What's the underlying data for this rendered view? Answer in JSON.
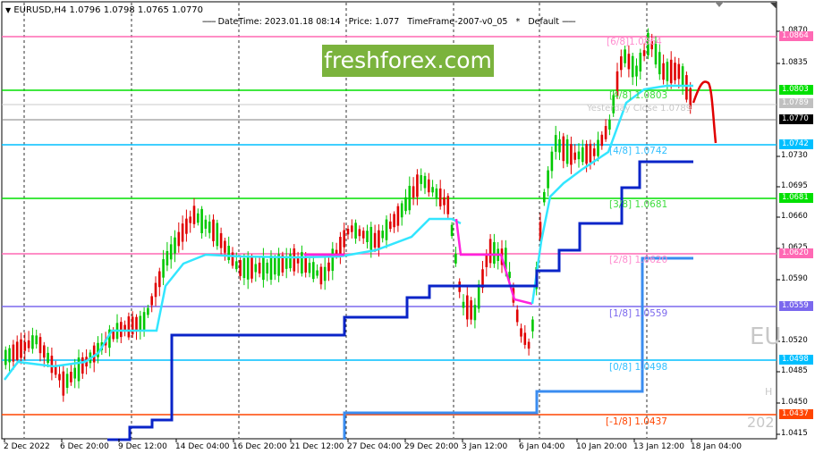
{
  "header": {
    "symbol_line": "EURUSD,H4  1.0796 1.0798 1.0765 1.0770"
  },
  "info_line": {
    "datetime": "DateTime: 2023.01.18 08:14",
    "price": "Price: 1.077",
    "timeframe": "TimeFrame-2007-v0_05",
    "star": "*",
    "default": "Default"
  },
  "brand": {
    "text": "freshforex.com"
  },
  "price_axis": {
    "ticks": [
      "1.0870",
      "1.0835",
      "1.0730",
      "1.0695",
      "1.0660",
      "1.0625",
      "1.0590",
      "1.0520",
      "1.0485",
      "1.0450",
      "1.0415"
    ],
    "labels": [
      {
        "text": "1.0864",
        "bg": "#ff69b4",
        "fg": "#ffffff"
      },
      {
        "text": "1.0803",
        "bg": "#00e000",
        "fg": "#ffffff"
      },
      {
        "text": "1.0789",
        "bg": "#c0c0c0",
        "fg": "#ffffff"
      },
      {
        "text": "1.0770",
        "bg": "#000000",
        "fg": "#ffffff"
      },
      {
        "text": "1.0742",
        "bg": "#00bfff",
        "fg": "#ffffff"
      },
      {
        "text": "1.0681",
        "bg": "#00e000",
        "fg": "#ffffff"
      },
      {
        "text": "1.0620",
        "bg": "#ff69b4",
        "fg": "#ffffff"
      },
      {
        "text": "1.0559",
        "bg": "#7b68ee",
        "fg": "#ffffff"
      },
      {
        "text": "1.0498",
        "bg": "#00bfff",
        "fg": "#ffffff"
      },
      {
        "text": "1.0437",
        "bg": "#ff4500",
        "fg": "#ffffff"
      }
    ]
  },
  "time_axis": [
    "2 Dec 2022",
    "6 Dec 20:00",
    "9 Dec 12:00",
    "14 Dec 04:00",
    "16 Dec 20:00",
    "21 Dec 12:00",
    "27 Dec 04:00",
    "29 Dec 20:00",
    "3 Jan 12:00",
    "6 Jan 04:00",
    "10 Jan 20:00",
    "13 Jan 12:00",
    "18 Jan 04:00"
  ],
  "murrey_levels": [
    {
      "label": "[6/8]",
      "value": "1.0864",
      "color": "#ff8ccf"
    },
    {
      "label": "[4/8]",
      "value": "1.0803",
      "color": "#3ddc3d"
    },
    {
      "label": "[4/8]",
      "value": "1.0742",
      "color": "#33c0ff"
    },
    {
      "label": "[3/8]",
      "value": "1.0681",
      "color": "#3ddc3d"
    },
    {
      "label": "[2/8]",
      "value": "1.0620",
      "color": "#ff8ccf"
    },
    {
      "label": "[1/8]",
      "value": "1.0559",
      "color": "#7b68ee"
    },
    {
      "label": "[0/8]",
      "value": "1.0498",
      "color": "#33c0ff"
    },
    {
      "label": "[-1/8]",
      "value": "1.0437",
      "color": "#ff4500"
    }
  ],
  "yesterday_close": "Yesterday Close 1.0789",
  "ghost_text": {
    "sym": "EU",
    "tf": "H",
    "year": "202"
  },
  "colors": {
    "bull": "#00c800",
    "bear": "#e00000",
    "fast": "#33e6ff",
    "slow": "#0a24c8",
    "purple": "#ff22dd",
    "cap": "#3a8cf0"
  }
}
